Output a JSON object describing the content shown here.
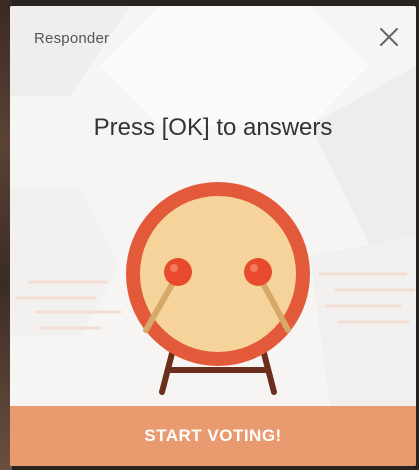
{
  "dialog": {
    "title": "Responder",
    "close_icon": "close-icon",
    "prompt": "Press [OK] to answers",
    "illustration": "drum-icon",
    "cta_label": "START VOTING!"
  },
  "colors": {
    "accent": "#e99a6e",
    "drum_rim": "#e35a3a",
    "drum_face": "#f6d39a",
    "stand": "#6b2f1c"
  }
}
